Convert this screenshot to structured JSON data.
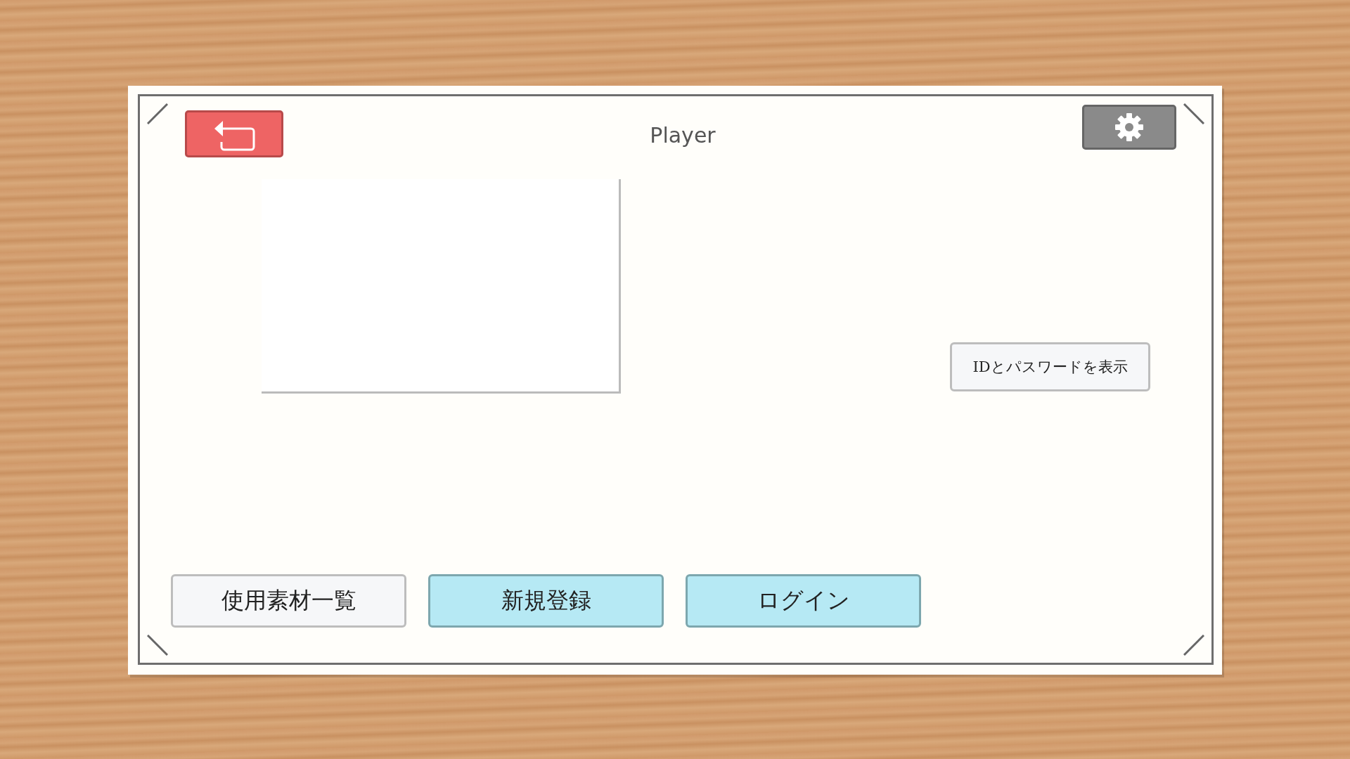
{
  "header": {
    "title": "Player"
  },
  "id_password_button": {
    "label": "IDとパスワードを表示"
  },
  "buttons": [
    {
      "label": "使用素材一覧",
      "kind": "plain"
    },
    {
      "label": "新規登録",
      "kind": "primary"
    },
    {
      "label": "ログイン",
      "kind": "primary"
    }
  ]
}
